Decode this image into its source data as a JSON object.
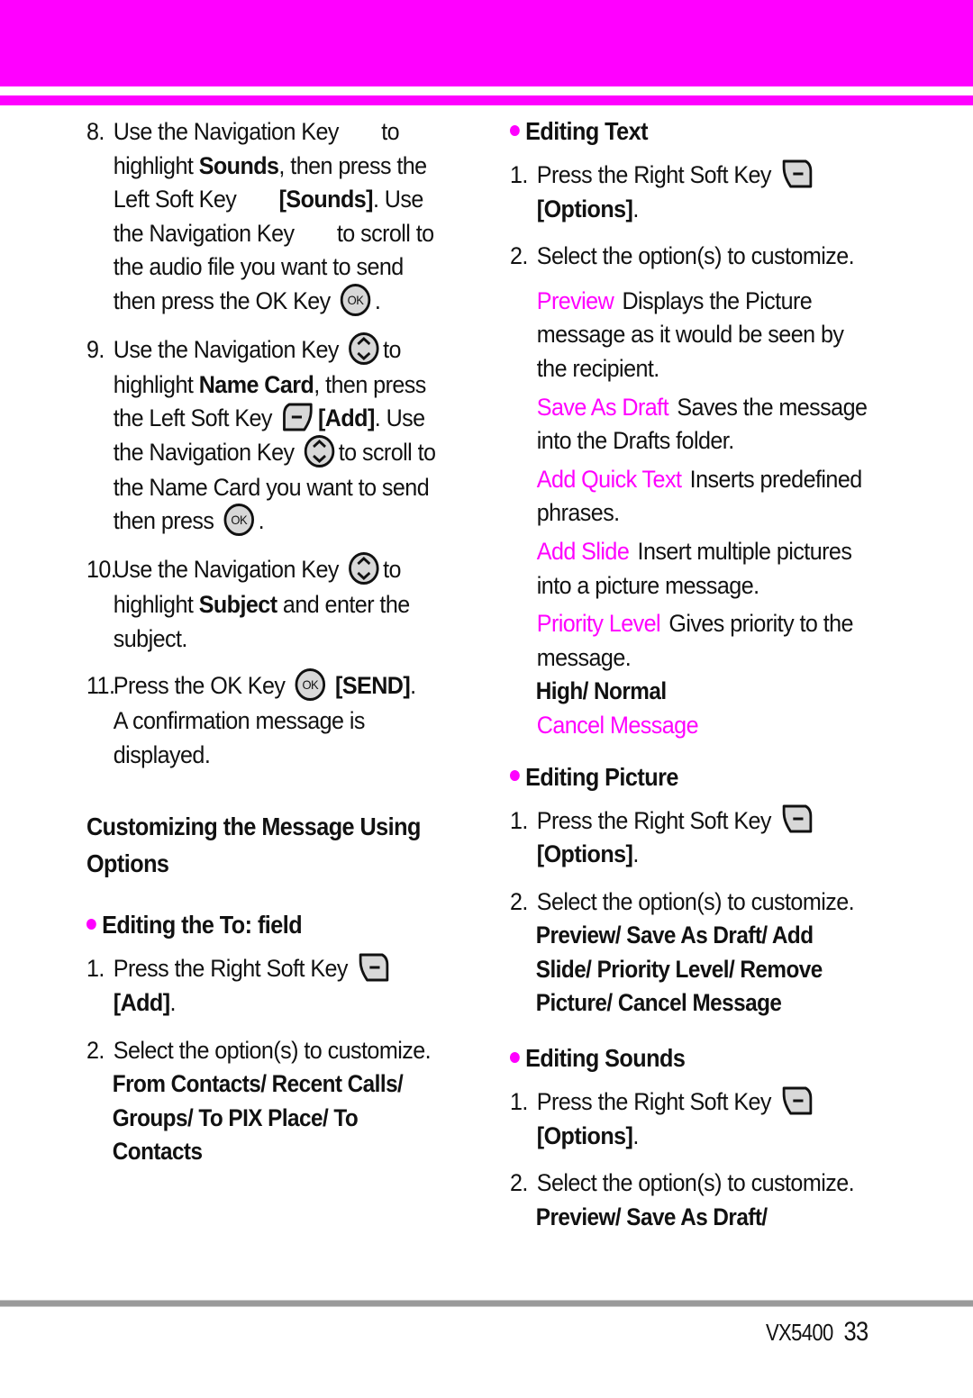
{
  "colors": {
    "accent": "#ff00ff",
    "rule": "#9a9a9a",
    "icon_fill": "#d8d8d8"
  },
  "left": {
    "step8": {
      "num": "8.",
      "t1": "Use the Navigation Key",
      "t2": "to",
      "t3": "highlight ",
      "b1": "Sounds",
      "t4": ", then press the",
      "t5": "Left Soft Key",
      "b2": "[Sounds]",
      "t6": ". Use",
      "t7": "the Navigation Key",
      "t8": "to scroll to",
      "t9": "the audio file you want to send",
      "t10": "then press the OK Key",
      "t11": "."
    },
    "step9": {
      "num": "9.",
      "t1": "Use the Navigation Key",
      "t2": "to",
      "t3": "highlight ",
      "b1": "Name Card",
      "t4": ", then press",
      "t5": "the Left Soft Key",
      "b2": "[Add]",
      "t6": ". Use",
      "t7": "the Navigation Key",
      "t8": "to scroll to",
      "t9": "the Name Card you want to send",
      "t10": "then press",
      "t11": "."
    },
    "step10": {
      "num": "10.",
      "t1": "Use the Navigation Key",
      "t2": "to",
      "t3": "highlight ",
      "b1": "Subject",
      "t4": " and enter the",
      "t5": "subject."
    },
    "step11": {
      "num": "11.",
      "t1": "Press the OK Key",
      "b1": "[SEND]",
      "t2": ".",
      "t3": "A confirmation message is",
      "t4": "displayed."
    },
    "section_heading_1": "Customizing the Message Using",
    "section_heading_2": "Options",
    "editing_to": {
      "title": "Editing the To: field",
      "step1": {
        "num": "1.",
        "text": "Press the Right Soft Key",
        "bold": "[Add]",
        "end": "."
      },
      "step2": {
        "num": "2.",
        "text": "Select the option(s) to customize."
      },
      "options": [
        "From Contacts/ Recent Calls/",
        "Groups/ To PIX Place/ To",
        "Contacts"
      ]
    }
  },
  "right": {
    "editing_text": {
      "title": "Editing Text",
      "step1": {
        "num": "1.",
        "text": "Press the Right Soft Key",
        "bold": "[Options]",
        "end": "."
      },
      "step2": {
        "num": "2.",
        "text": "Select the option(s) to customize."
      },
      "options": [
        {
          "name": "Preview",
          "desc": "Displays the Picture message as it would be seen by the recipient."
        },
        {
          "name": "Save As Draft",
          "desc": "Saves the message into the Drafts folder."
        },
        {
          "name": "Add Quick Text",
          "desc": "Inserts predefined phrases."
        },
        {
          "name": "Add Slide",
          "desc": "Insert multiple pictures into a picture message."
        },
        {
          "name": "Priority Level",
          "desc": "Gives priority to the message."
        }
      ],
      "priority_values": "High/ Normal",
      "cancel": "Cancel Message"
    },
    "editing_picture": {
      "title": "Editing Picture",
      "step1": {
        "num": "1.",
        "text": "Press the Right Soft Key",
        "bold": "[Options]",
        "end": "."
      },
      "step2": {
        "num": "2.",
        "text": "Select the option(s) to customize."
      },
      "options": [
        "Preview/ Save As Draft/ Add",
        "Slide/ Priority Level/ Remove",
        "Picture/ Cancel Message"
      ]
    },
    "editing_sounds": {
      "title": "Editing Sounds",
      "step1": {
        "num": "1.",
        "text": "Press the Right Soft Key",
        "bold": "[Options]",
        "end": "."
      },
      "step2": {
        "num": "2.",
        "text": "Select the option(s) to customize."
      },
      "options": [
        "Preview/ Save As Draft/"
      ]
    }
  },
  "footer": {
    "model": "VX5400",
    "page": "33"
  },
  "icons": {
    "nav": "navigation-key-icon",
    "ok": "ok-key-icon",
    "left_soft": "left-soft-key-icon",
    "right_soft": "right-soft-key-icon",
    "ok_label": "OK"
  }
}
